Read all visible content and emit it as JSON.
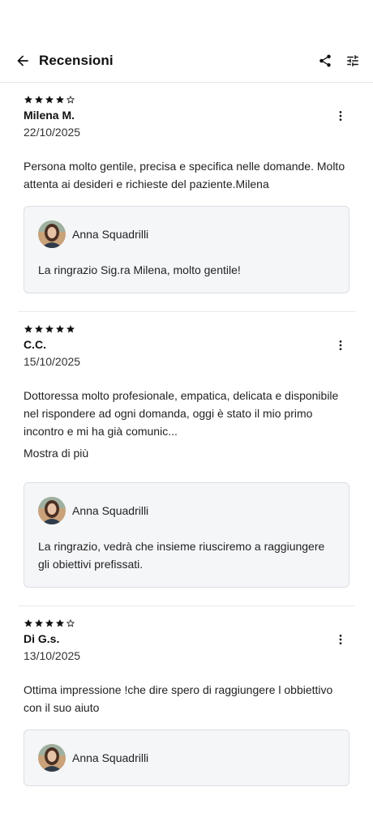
{
  "app_bar": {
    "title": "Recensioni",
    "back_icon": "arrow-left-icon",
    "share_icon": "share-icon",
    "filter_icon": "tune-icon"
  },
  "reviews": [
    {
      "rating": 4,
      "max_rating": 5,
      "author": "Milena M.",
      "date": "22/10/2025",
      "text": "Persona molto gentile, precisa e specifica nelle domande. Molto attenta ai desideri e richieste del paziente.Milena",
      "show_more": "",
      "reply": {
        "author": "Anna Squadrilli",
        "text": "La ringrazio Sig.ra Milena, molto gentile!"
      }
    },
    {
      "rating": 5,
      "max_rating": 5,
      "author": "C.C.",
      "date": "15/10/2025",
      "text": "Dottoressa molto profesionale, empatica, delicata e disponibile nel rispondere ad ogni domanda, oggi è stato il mio primo incontro e mi ha già comunic...",
      "show_more": "Mostra di più",
      "reply": {
        "author": "Anna Squadrilli",
        "text": "La ringrazio, vedrà che insieme riusciremo a raggiungere gli obiettivi prefissati."
      }
    },
    {
      "rating": 4,
      "max_rating": 5,
      "author": "Di G.s.",
      "date": "13/10/2025",
      "text": "Ottima impressione !che dire spero di raggiungere  l obbiettivo con il suo aiuto",
      "show_more": "",
      "reply": {
        "author": "Anna Squadrilli",
        "text": ""
      }
    }
  ],
  "colors": {
    "text": "#1a1a1a",
    "divider": "#e6e6e6",
    "reply_bg": "#f5f6f8",
    "reply_border": "#dcdee3"
  }
}
